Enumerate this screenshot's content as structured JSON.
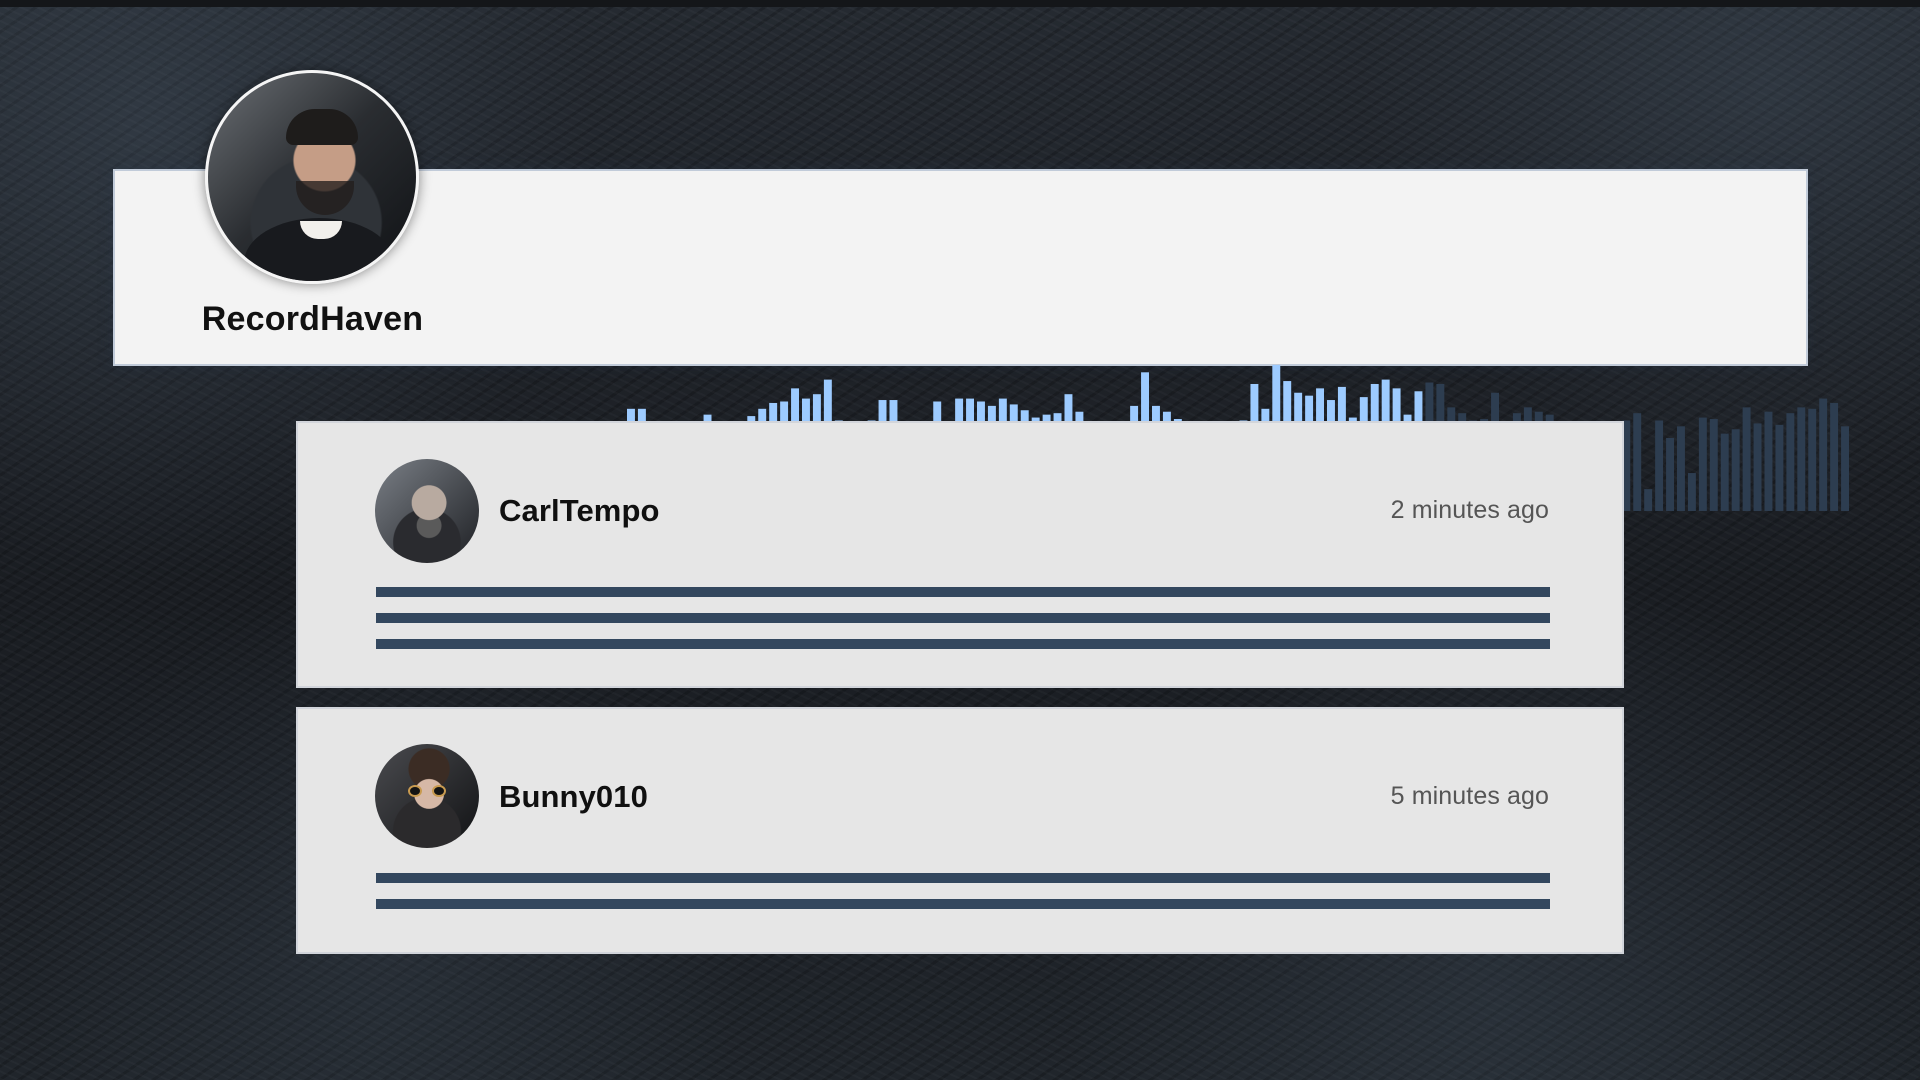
{
  "player": {
    "artist_name": "RecordHaven",
    "avatar_icon": "artist-avatar-photo",
    "waveform": {
      "played_color": "#9dcbff",
      "unplayed_color": "#2d3d50",
      "progress_fraction": 0.65,
      "levels": [
        0.7,
        0.7,
        0.33,
        0.61,
        0.59,
        0.54,
        0.11,
        0.66,
        0.58,
        0.18,
        0.28,
        0.65,
        0.7,
        0.74,
        0.75,
        0.84,
        0.77,
        0.8,
        0.9,
        0.62,
        0.52,
        0.59,
        0.62,
        0.76,
        0.76,
        0.59,
        0.51,
        0.3,
        0.75,
        0.6,
        0.77,
        0.77,
        0.75,
        0.72,
        0.77,
        0.73,
        0.69,
        0.64,
        0.66,
        0.67,
        0.8,
        0.68,
        0.61,
        0.57,
        0.58,
        0.56,
        0.72,
        0.95,
        0.72,
        0.68,
        0.63,
        0.56,
        0.61,
        0.61,
        0.59,
        0.61,
        0.62,
        0.87,
        0.7,
        1.0,
        0.89,
        0.81,
        0.79,
        0.84,
        0.76,
        0.85,
        0.64,
        0.78,
        0.87,
        0.9,
        0.84,
        0.66,
        0.82,
        0.88,
        0.87,
        0.71,
        0.67,
        0.62,
        0.63,
        0.81,
        0.44,
        0.67,
        0.71,
        0.68,
        0.66,
        0.61,
        0.45,
        0.57,
        0.61,
        0.45,
        0.59,
        0.62,
        0.67,
        0.15,
        0.62,
        0.5,
        0.58,
        0.26,
        0.64,
        0.63,
        0.53,
        0.56,
        0.71,
        0.6,
        0.68,
        0.59,
        0.67,
        0.71,
        0.7,
        0.77,
        0.74,
        0.58
      ]
    }
  },
  "comments": [
    {
      "username": "CarlTempo",
      "time": "2 minutes ago",
      "avatar_icon": "commenter-avatar-photo",
      "line_count": 3
    },
    {
      "username": "Bunny010",
      "time": "5 minutes ago",
      "avatar_icon": "commenter-avatar-photo",
      "line_count": 2
    }
  ]
}
